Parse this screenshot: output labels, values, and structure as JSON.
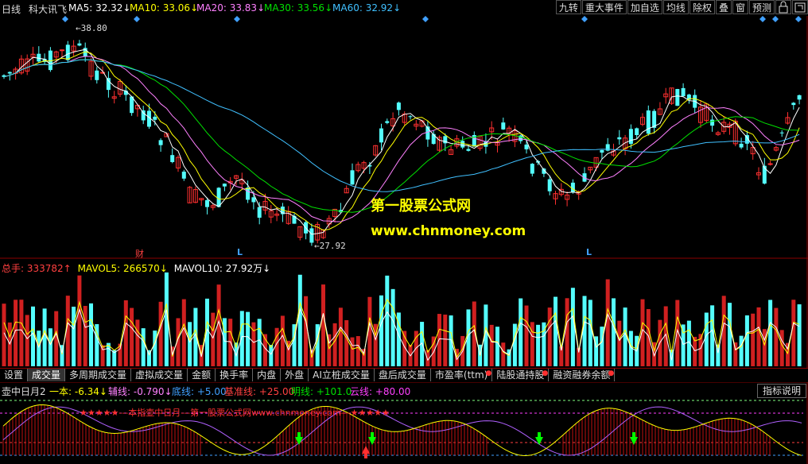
{
  "header": {
    "period": "日线",
    "stock_name": "科大讯飞",
    "ma5": {
      "label": "MA5: ",
      "value": "32.32",
      "arrow": "↓",
      "color": "#ffffff"
    },
    "ma10": {
      "label": "MA10: ",
      "value": "33.06",
      "arrow": "↓",
      "color": "#ffff00"
    },
    "ma20": {
      "label": "MA20: ",
      "value": "33.83",
      "arrow": "↓",
      "color": "#ff80ff"
    },
    "ma30": {
      "label": "MA30: ",
      "value": "33.56",
      "arrow": "↓",
      "color": "#00e000"
    },
    "ma60": {
      "label": "MA60: ",
      "value": "32.92",
      "arrow": "↓",
      "color": "#40c0ff"
    }
  },
  "toolbar": {
    "buttons": [
      "九转",
      "重大事件",
      "加自选",
      "均线",
      "除权",
      "叠",
      "窗",
      "预测"
    ],
    "lock_icon": "lock-icon",
    "expand_icon": "expand-icon"
  },
  "price_chart": {
    "high_label": "38.80",
    "low_label": "27.92",
    "event_markers": [
      "财",
      "L",
      "L"
    ]
  },
  "watermark": {
    "name": "第一股票公式网",
    "url": "www.chnmoney.com"
  },
  "volume_header": {
    "total": {
      "label": "总手: ",
      "value": "333782",
      "arrow": "↑",
      "color": "#ff4040"
    },
    "mavol5": {
      "label": "MAVOL5: ",
      "value": "266570",
      "arrow": "↓",
      "color": "#ffff00"
    },
    "mavol10": {
      "label": "MAVOL10: ",
      "value": "27.92万",
      "arrow": "↓",
      "color": "#ffffff"
    }
  },
  "tabs": [
    {
      "label": "设置",
      "active": false,
      "dot": false
    },
    {
      "label": "成交量",
      "active": true,
      "dot": false
    },
    {
      "label": "多周期成交量",
      "active": false,
      "dot": false
    },
    {
      "label": "虚拟成交量",
      "active": false,
      "dot": false
    },
    {
      "label": "金额",
      "active": false,
      "dot": false
    },
    {
      "label": "换手率",
      "active": false,
      "dot": false
    },
    {
      "label": "内盘",
      "active": false,
      "dot": false
    },
    {
      "label": "外盘",
      "active": false,
      "dot": false
    },
    {
      "label": "AI立桩成交量",
      "active": false,
      "dot": false
    },
    {
      "label": "盘后成交量",
      "active": false,
      "dot": false
    },
    {
      "label": "市盈率(ttm)",
      "active": false,
      "dot": true
    },
    {
      "label": "陆股通持股",
      "active": false,
      "dot": true
    },
    {
      "label": "融资融券余额",
      "active": false,
      "dot": true
    }
  ],
  "indicator": {
    "name": "壶中日月2",
    "yiben": {
      "label": "一本: ",
      "value": "-6.34",
      "arrow": "↓",
      "color": "#ffff00"
    },
    "fuxian": {
      "label": "辅线: ",
      "value": "-0.790",
      "arrow": "↓",
      "color": "#ff80ff"
    },
    "dixian": {
      "label": "底线: ",
      "value": "+5.00",
      "color": "#40a0ff"
    },
    "jizhun": {
      "label": "基准线: ",
      "value": "+25.00",
      "color": "#ff4040"
    },
    "mingxian": {
      "label": "明线: ",
      "value": "+101.0",
      "color": "#00e000"
    },
    "yunxian": {
      "label": "云线: ",
      "value": "+80.00",
      "color": "#ff40ff"
    },
    "help_button": "指标说明",
    "banner": "★★★★★---本指壶中日月---第一股票公式网www.chnmoney.com---★★★★★"
  }
}
